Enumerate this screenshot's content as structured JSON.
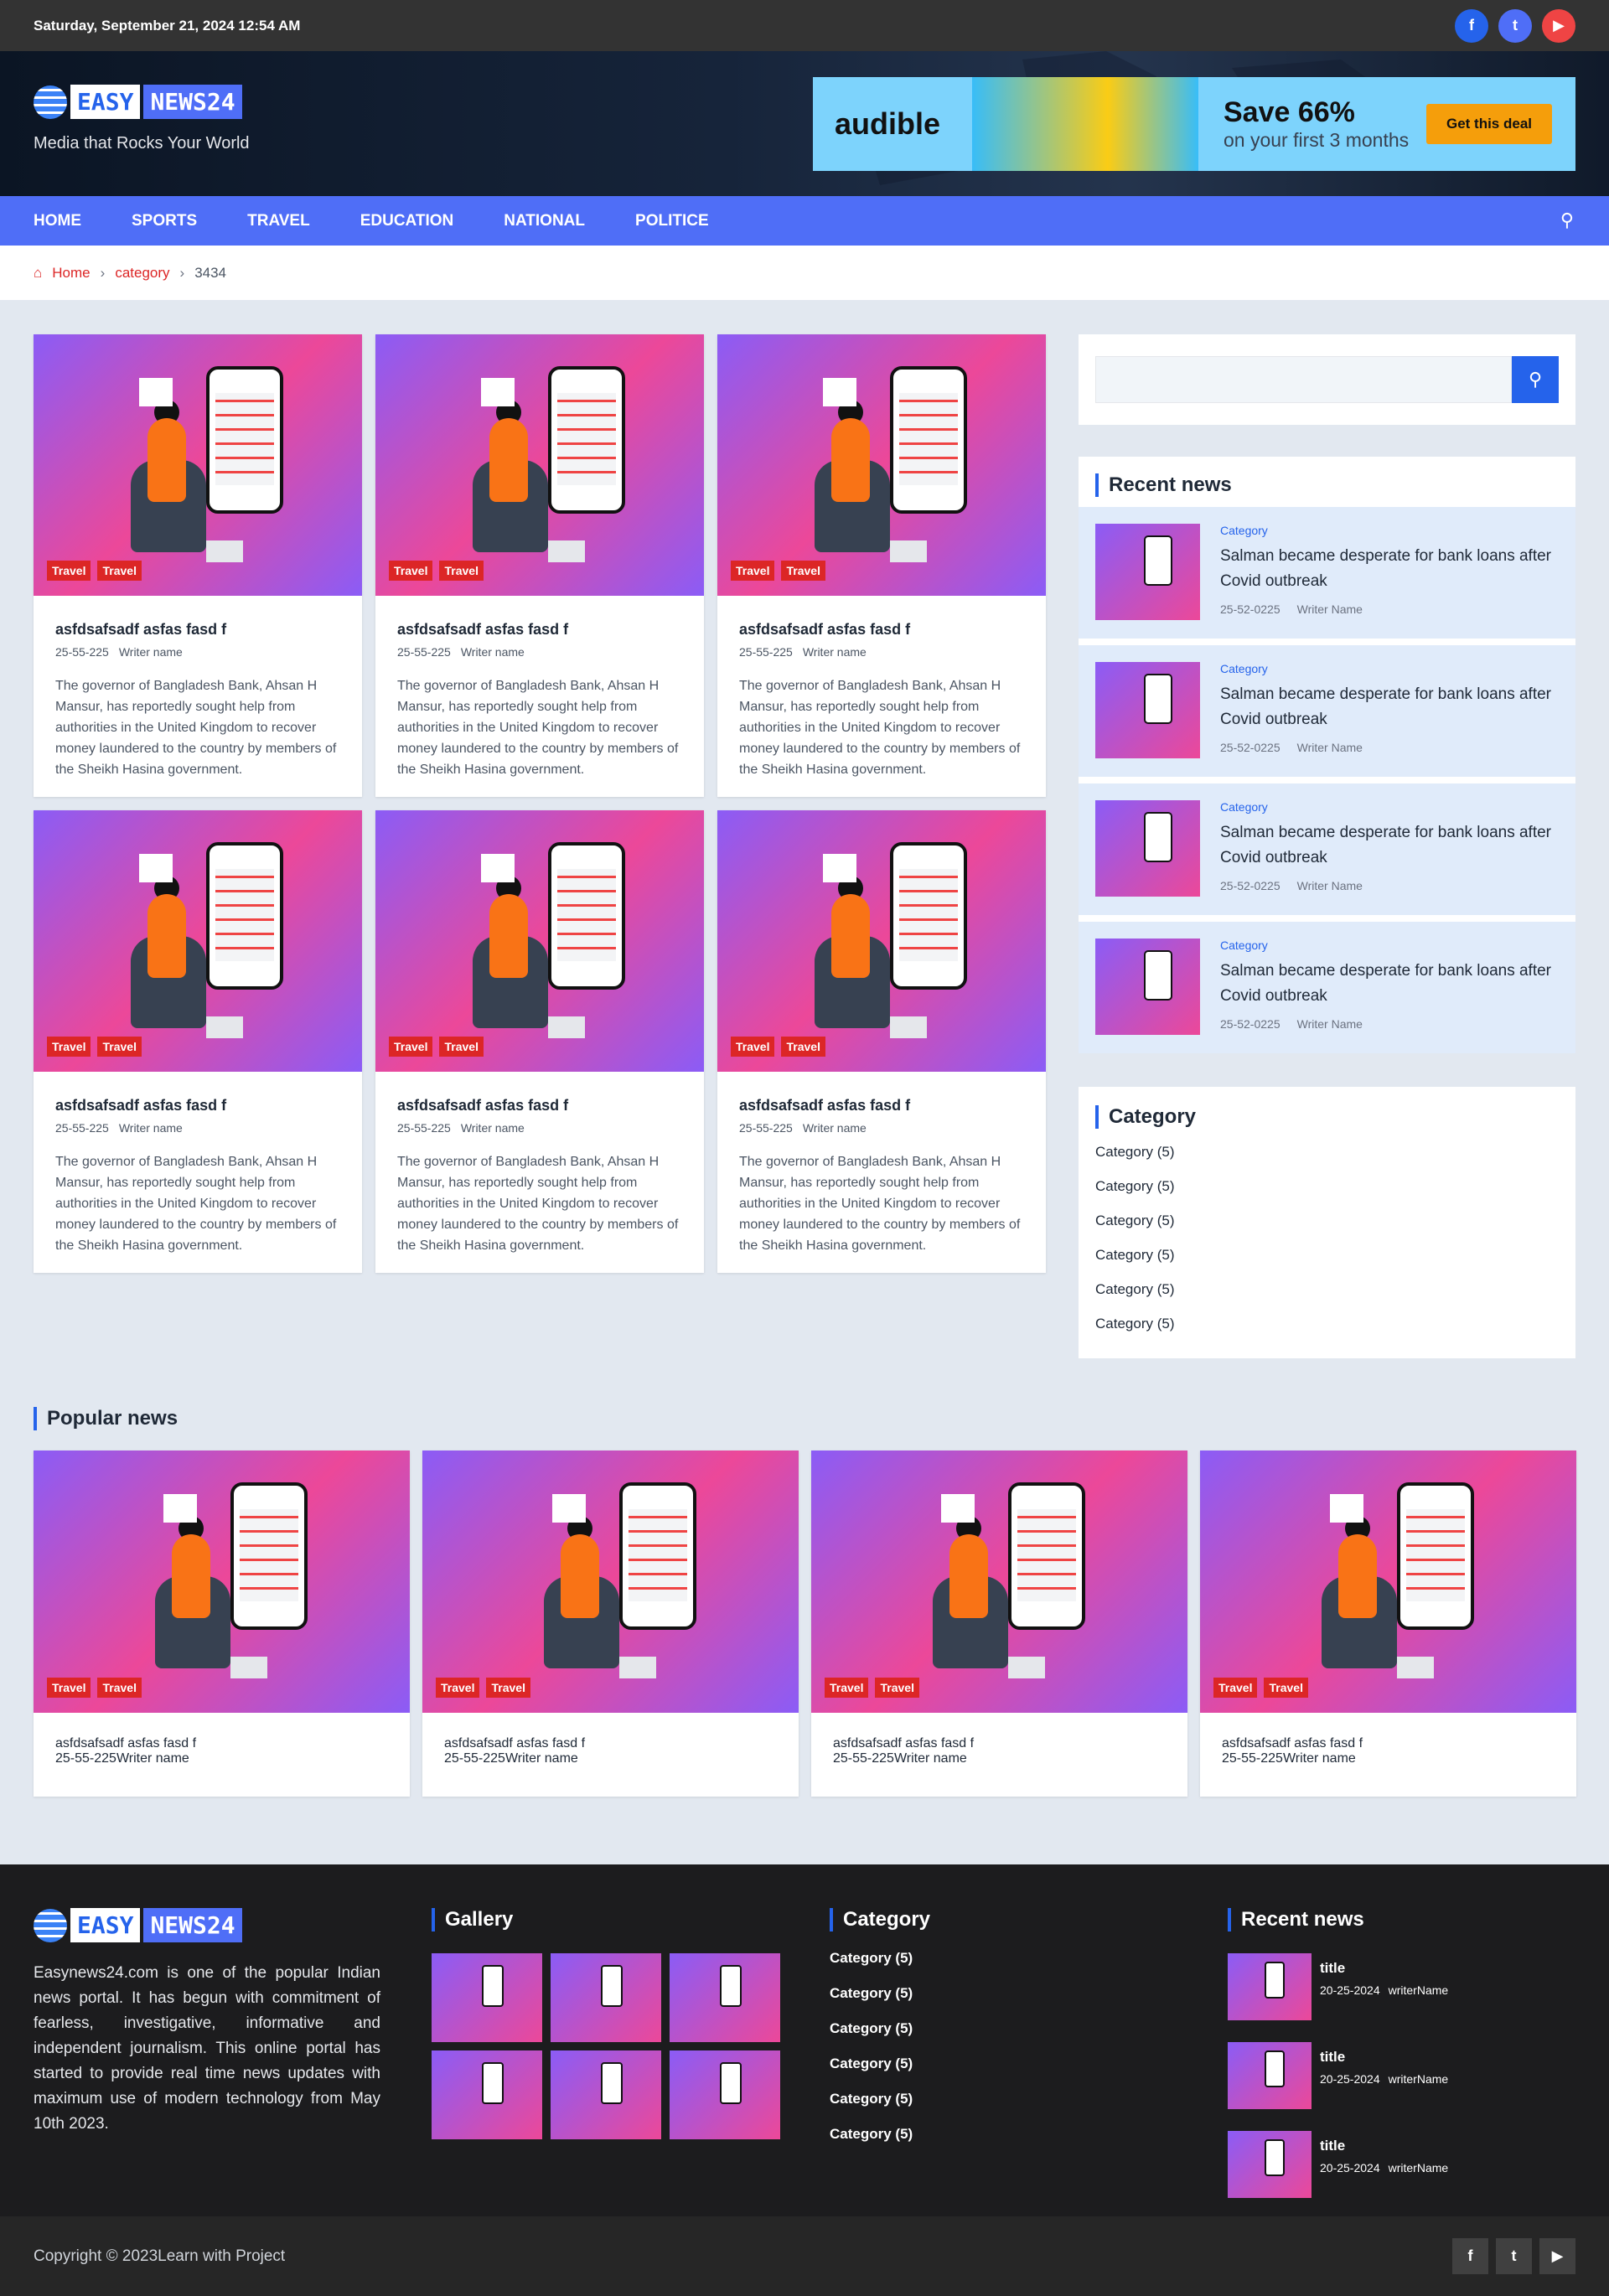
{
  "topbar": {
    "date": "Saturday, September 21, 2024 12:54 AM",
    "social": [
      {
        "icon": "facebook-icon",
        "glyph": "f",
        "color": "#2563eb"
      },
      {
        "icon": "twitter-icon",
        "glyph": "t",
        "color": "#4f6ef7"
      },
      {
        "icon": "youtube-icon",
        "glyph": "▶",
        "color": "#ef4444"
      }
    ]
  },
  "header": {
    "logo_easy": "EASY",
    "logo_news": "NEWS24",
    "tagline": "Media that Rocks Your World"
  },
  "ad": {
    "brand": "audible",
    "headline": "Save 66%",
    "sub": "on your first 3 months",
    "cta": "Get this deal"
  },
  "nav": {
    "items": [
      "HOME",
      "SPORTS",
      "TRAVEL",
      "EDUCATION",
      "NATIONAL",
      "POLITICE"
    ]
  },
  "breadcrumb": {
    "home": "Home",
    "category": "category",
    "current": "3434"
  },
  "articles": [
    {
      "tags": [
        "Travel",
        "Travel"
      ],
      "title": "asfdsafsadf asfas fasd f",
      "date": "25-55-225",
      "writer": "Writer name",
      "excerpt": "The governor of Bangladesh Bank, Ahsan H Mansur, has reportedly sought help from authorities in the United Kingdom to recover money laundered to the country by members of the Sheikh Hasina government."
    },
    {
      "tags": [
        "Travel",
        "Travel"
      ],
      "title": "asfdsafsadf asfas fasd f",
      "date": "25-55-225",
      "writer": "Writer name",
      "excerpt": "The governor of Bangladesh Bank, Ahsan H Mansur, has reportedly sought help from authorities in the United Kingdom to recover money laundered to the country by members of the Sheikh Hasina government."
    },
    {
      "tags": [
        "Travel",
        "Travel"
      ],
      "title": "asfdsafsadf asfas fasd f",
      "date": "25-55-225",
      "writer": "Writer name",
      "excerpt": "The governor of Bangladesh Bank, Ahsan H Mansur, has reportedly sought help from authorities in the United Kingdom to recover money laundered to the country by members of the Sheikh Hasina government."
    },
    {
      "tags": [
        "Travel",
        "Travel"
      ],
      "title": "asfdsafsadf asfas fasd f",
      "date": "25-55-225",
      "writer": "Writer name",
      "excerpt": "The governor of Bangladesh Bank, Ahsan H Mansur, has reportedly sought help from authorities in the United Kingdom to recover money laundered to the country by members of the Sheikh Hasina government."
    },
    {
      "tags": [
        "Travel",
        "Travel"
      ],
      "title": "asfdsafsadf asfas fasd f",
      "date": "25-55-225",
      "writer": "Writer name",
      "excerpt": "The governor of Bangladesh Bank, Ahsan H Mansur, has reportedly sought help from authorities in the United Kingdom to recover money laundered to the country by members of the Sheikh Hasina government."
    },
    {
      "tags": [
        "Travel",
        "Travel"
      ],
      "title": "asfdsafsadf asfas fasd f",
      "date": "25-55-225",
      "writer": "Writer name",
      "excerpt": "The governor of Bangladesh Bank, Ahsan H Mansur, has reportedly sought help from authorities in the United Kingdom to recover money laundered to the country by members of the Sheikh Hasina government."
    }
  ],
  "sidebar": {
    "search_placeholder": "",
    "recent_title": "Recent news",
    "recent": [
      {
        "category": "Category",
        "title": "Salman became desperate for bank loans after Covid outbreak",
        "date": "25-52-0225",
        "writer": "Writer Name"
      },
      {
        "category": "Category",
        "title": "Salman became desperate for bank loans after Covid outbreak",
        "date": "25-52-0225",
        "writer": "Writer Name"
      },
      {
        "category": "Category",
        "title": "Salman became desperate for bank loans after Covid outbreak",
        "date": "25-52-0225",
        "writer": "Writer Name"
      },
      {
        "category": "Category",
        "title": "Salman became desperate for bank loans after Covid outbreak",
        "date": "25-52-0225",
        "writer": "Writer Name"
      }
    ],
    "category_title": "Category",
    "categories": [
      "Category (5)",
      "Category (5)",
      "Category (5)",
      "Category (5)",
      "Category (5)",
      "Category (5)"
    ]
  },
  "popular": {
    "title": "Popular news",
    "items": [
      {
        "tags": [
          "Travel",
          "Travel"
        ],
        "title": "asfdsafsadf asfas fasd f",
        "date": "25-55-225",
        "writer": "Writer name"
      },
      {
        "tags": [
          "Travel",
          "Travel"
        ],
        "title": "asfdsafsadf asfas fasd f",
        "date": "25-55-225",
        "writer": "Writer name"
      },
      {
        "tags": [
          "Travel",
          "Travel"
        ],
        "title": "asfdsafsadf asfas fasd f",
        "date": "25-55-225",
        "writer": "Writer name"
      },
      {
        "tags": [
          "Travel",
          "Travel"
        ],
        "title": "asfdsafsadf asfas fasd f",
        "date": "25-55-225",
        "writer": "Writer name"
      }
    ]
  },
  "footer": {
    "description": "Easynews24.com is one of the popular Indian news portal. It has begun with commitment of fearless, investigative, informative and independent journalism. This online portal has started to provide real time news updates with maximum use of modern technology from May 10th 2023.",
    "gallery_title": "Gallery",
    "category_title": "Category",
    "categories": [
      "Category (5)",
      "Category (5)",
      "Category (5)",
      "Category (5)",
      "Category (5)",
      "Category (5)"
    ],
    "recent_title": "Recent news",
    "recent": [
      {
        "title": "title",
        "date": "20-25-2024",
        "writer": "writerName"
      },
      {
        "title": "title",
        "date": "20-25-2024",
        "writer": "writerName"
      },
      {
        "title": "title",
        "date": "20-25-2024",
        "writer": "writerName"
      }
    ],
    "copyright": "Copyright © 2023Learn with Project"
  }
}
